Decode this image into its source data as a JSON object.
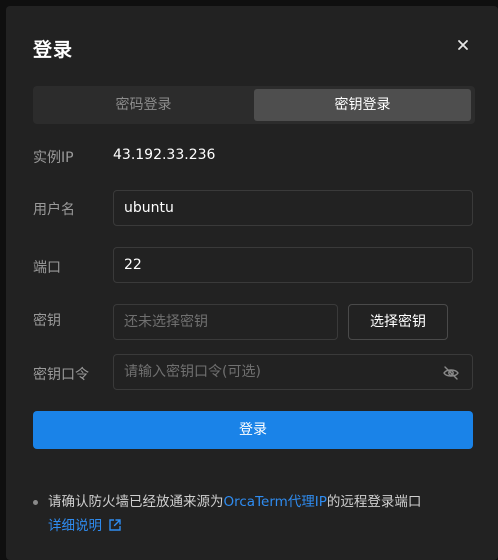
{
  "dialog": {
    "title": "登录",
    "close_icon": "close-icon"
  },
  "tabs": [
    {
      "label": "密码登录",
      "active": false
    },
    {
      "label": "密钥登录",
      "active": true
    }
  ],
  "form": {
    "ip_label": "实例IP",
    "ip_value": "43.192.33.236",
    "username_label": "用户名",
    "username_value": "ubuntu",
    "port_label": "端口",
    "port_value": "22",
    "key_label": "密钥",
    "key_placeholder": "还未选择密钥",
    "select_key_button": "选择密钥",
    "passphrase_label": "密钥口令",
    "passphrase_placeholder": "请输入密钥口令(可选)",
    "passphrase_toggle_icon": "eye-off-icon"
  },
  "submit": {
    "label": "登录"
  },
  "notice": {
    "text_before": "请确认防火墙已经放通来源为",
    "link_text": "OrcaTerm代理IP",
    "text_after": "的远程登录端口",
    "details_link": "详细说明",
    "details_icon": "external-link-icon"
  },
  "colors": {
    "primary": "#1a83e8",
    "link": "#2f8cf0",
    "background": "#222222"
  }
}
